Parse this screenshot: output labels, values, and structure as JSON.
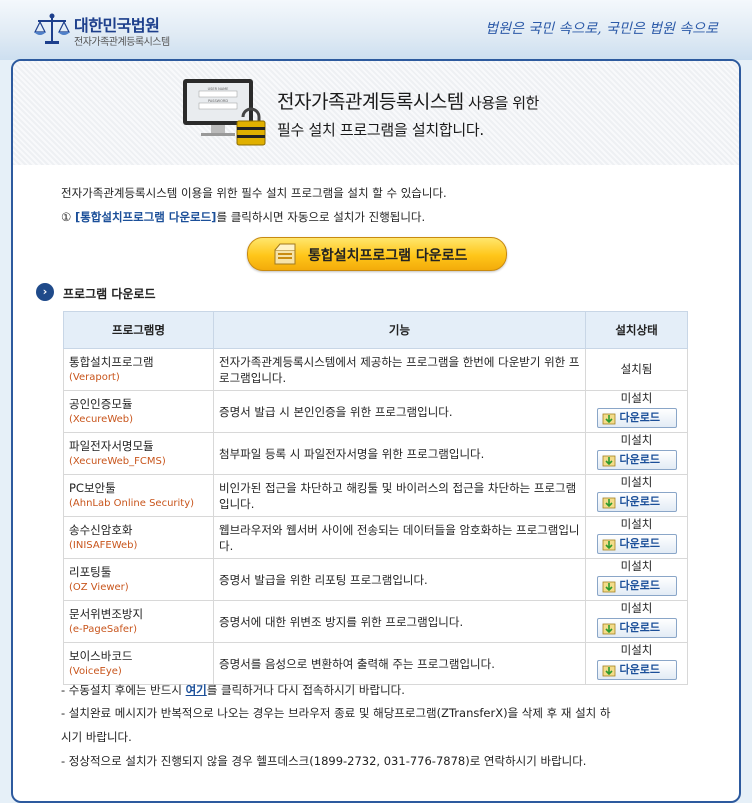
{
  "header": {
    "court_name": "대한민국법원",
    "system_name": "전자가족관계등록시스템",
    "slogan": "법원은 국민 속으로, 국민은 법원 속으로"
  },
  "hero": {
    "title_main": "전자가족관계등록시스템",
    "title_suffix": " 사용을 위한",
    "subtitle": "필수 설치 프로그램을 설치합니다.",
    "login_placeholder_user": "USER NAME",
    "login_placeholder_pass": "PASSWORD"
  },
  "intro": {
    "line1": "전자가족관계등록시스템 이용을 위한 필수 설치 프로그램을 설치 할 수 있습니다.",
    "line2_prefix": "① ",
    "line2_link": "[통합설치프로그램 다운로드]",
    "line2_suffix": "를 클릭하시면 자동으로 설치가 진행됩니다."
  },
  "install_button_label": "통합설치프로그램 다운로드",
  "section": {
    "title": "프로그램 다운로드"
  },
  "table": {
    "headers": [
      "프로그램명",
      "기능",
      "설치상태"
    ],
    "rows": [
      {
        "name": "통합설치프로그램",
        "module": "(Veraport)",
        "desc": "전자가족관계등록시스템에서 제공하는 프로그램을 한번에 다운받기 위한 프로그램입니다.",
        "status": "설치됨",
        "download": ""
      },
      {
        "name": "공인인증모듈",
        "module": "(XecureWeb)",
        "desc": "증명서 발급 시 본인인증을 위한 프로그램입니다.",
        "status": "미설치",
        "download": "다운로드"
      },
      {
        "name": "파일전자서명모듈",
        "module": "(XecureWeb_FCMS)",
        "desc": "첨부파일 등록 시 파일전자서명을 위한 프로그램입니다.",
        "status": "미설치",
        "download": "다운로드"
      },
      {
        "name": "PC보안툴",
        "module": "(AhnLab Online Security)",
        "desc": "비인가된 접근을 차단하고 해킹툴 및 바이러스의 접근을 차단하는 프로그램입니다.",
        "status": "미설치",
        "download": "다운로드"
      },
      {
        "name": "송수신암호화",
        "module": "(INISAFEWeb)",
        "desc": "웹브라우저와 웹서버 사이에 전송되는 데이터들을 암호화하는 프로그램입니다.",
        "status": "미설치",
        "download": "다운로드"
      },
      {
        "name": "리포팅툴",
        "module": "(OZ Viewer)",
        "desc": "증명서 발급을 위한 리포팅 프로그램입니다.",
        "status": "미설치",
        "download": "다운로드"
      },
      {
        "name": "문서위변조방지",
        "module": "(e-PageSafer)",
        "desc": "증명서에 대한 위변조 방지를 위한 프로그램입니다.",
        "status": "미설치",
        "download": "다운로드"
      },
      {
        "name": "보이스바코드",
        "module": "(VoiceEye)",
        "desc": "증명서를 음성으로 변환하여 출력해 주는 프로그램입니다.",
        "status": "미설치",
        "download": "다운로드"
      }
    ]
  },
  "notes": {
    "note1_prefix": "- 수동설치 후에는 반드시 ",
    "note1_link": "여기",
    "note1_suffix": "를 클릭하거나 다시 접속하시기 바랍니다.",
    "note2": "- 설치완료 메시지가 반복적으로 나오는 경우는 브라우저 종료 및 해당프로그램(ZTransferX)을 삭제 후 재 설치 하",
    "note3": "시기 바랍니다.",
    "note4": "- 정상적으로 설치가 진행되지 않을 경우 헬프데스크(1899-2732, 031-776-7878)로 연락하시기 바랍니다."
  }
}
